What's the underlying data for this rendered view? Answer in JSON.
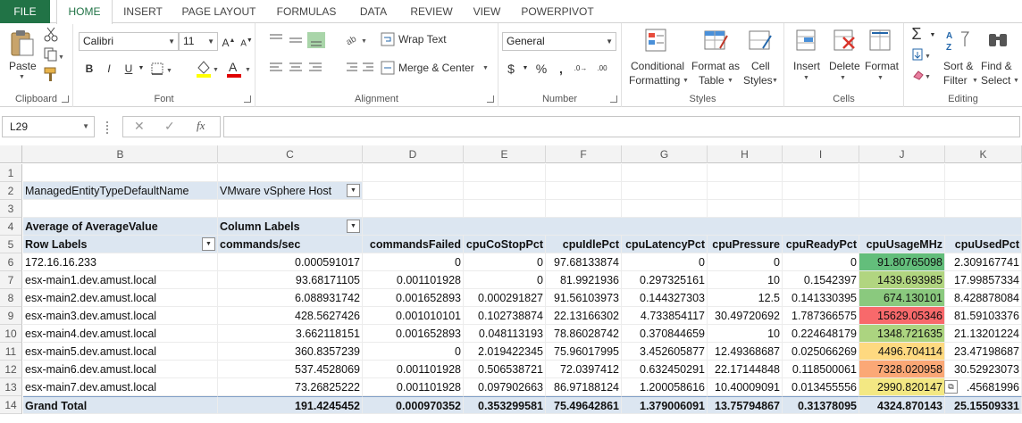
{
  "tabs": [
    "FILE",
    "HOME",
    "INSERT",
    "PAGE LAYOUT",
    "FORMULAS",
    "DATA",
    "REVIEW",
    "VIEW",
    "POWERPIVOT"
  ],
  "ribbon": {
    "clipboard": {
      "paste": "Paste",
      "label": "Clipboard"
    },
    "font": {
      "name": "Calibri",
      "size": "11",
      "label": "Font"
    },
    "alignment": {
      "wrap": "Wrap Text",
      "merge": "Merge & Center",
      "label": "Alignment"
    },
    "number": {
      "format": "General",
      "label": "Number"
    },
    "styles": {
      "conditional": "Conditional",
      "formatting": "Formatting",
      "format_as": "Format as",
      "table": "Table",
      "cell": "Cell",
      "styles_btn": "Styles",
      "label": "Styles"
    },
    "cells": {
      "insert": "Insert",
      "delete": "Delete",
      "format": "Format",
      "label": "Cells"
    },
    "editing": {
      "sort": "Sort &",
      "filter": "Filter",
      "find": "Find &",
      "select": "Select",
      "label": "Editing"
    }
  },
  "formula_bar": {
    "name_box": "L29",
    "fx": "fx",
    "content": ""
  },
  "columns": [
    "B",
    "C",
    "D",
    "E",
    "F",
    "G",
    "H",
    "I",
    "J",
    "K"
  ],
  "colors": {
    "brand": "#217346",
    "pivot_header": "#dce6f1"
  },
  "sheet": {
    "row_numbers": [
      "1",
      "2",
      "3",
      "4",
      "5",
      "6",
      "7",
      "8",
      "9",
      "10",
      "11",
      "12",
      "13",
      "14"
    ],
    "filter_field": "ManagedEntityTypeDefaultName",
    "filter_value": "VMware vSphere Host",
    "pivot_title": "Average of AverageValue",
    "column_labels": "Column Labels",
    "row_labels": "Row Labels",
    "headers": [
      "commands/sec",
      "commandsFailed",
      "cpuCoStopPct",
      "cpuIdlePct",
      "cpuLatencyPct",
      "cpuPressure",
      "cpuReadyPct",
      "cpuUsageMHz",
      "cpuUsedPct"
    ],
    "data": [
      {
        "label": "172.16.16.233",
        "values": [
          "0.000591017",
          "0",
          "0",
          "97.68133874",
          "0",
          "0",
          "0",
          "91.80765098",
          "2.309167741"
        ],
        "heat": "#63be7b"
      },
      {
        "label": "esx-main1.dev.amust.local",
        "values": [
          "93.68171105",
          "0.001101928",
          "0",
          "81.9921936",
          "0.297325161",
          "10",
          "0.1542397",
          "1439.693985",
          "17.99857334"
        ],
        "heat": "#b1d580"
      },
      {
        "label": "esx-main2.dev.amust.local",
        "values": [
          "6.088931742",
          "0.001652893",
          "0.000291827",
          "91.56103973",
          "0.144327303",
          "12.5",
          "0.141330395",
          "674.130101",
          "8.428878084"
        ],
        "heat": "#8ac97e"
      },
      {
        "label": "esx-main3.dev.amust.local",
        "values": [
          "428.5627426",
          "0.001010101",
          "0.102738874",
          "22.13166302",
          "4.733854117",
          "30.49720692",
          "1.787366575",
          "15629.05346",
          "81.59103376"
        ],
        "heat": "#f8696b"
      },
      {
        "label": "esx-main4.dev.amust.local",
        "values": [
          "3.662118151",
          "0.001652893",
          "0.048113193",
          "78.86028742",
          "0.370844659",
          "10",
          "0.224648179",
          "1348.721635",
          "21.13201224"
        ],
        "heat": "#acd480"
      },
      {
        "label": "esx-main5.dev.amust.local",
        "values": [
          "360.8357239",
          "0",
          "2.019422345",
          "75.96017995",
          "3.452605877",
          "12.49368687",
          "0.025066269",
          "4496.704114",
          "23.47198687"
        ],
        "heat": "#fed980"
      },
      {
        "label": "esx-main6.dev.amust.local",
        "values": [
          "537.4528069",
          "0.001101928",
          "0.506538721",
          "72.0397412",
          "0.632450291",
          "22.17144848",
          "0.118500061",
          "7328.020958",
          "30.52923073"
        ],
        "heat": "#fba876"
      },
      {
        "label": "esx-main7.dev.amust.local",
        "values": [
          "73.26825222",
          "0.001101928",
          "0.097902663",
          "86.97188124",
          "1.200058616",
          "10.40009091",
          "0.013455556",
          "2990.820147",
          ".45681996"
        ],
        "heat": "#f3e883"
      }
    ],
    "grand_total": {
      "label": "Grand Total",
      "values": [
        "191.4245452",
        "0.000970352",
        "0.353299581",
        "75.49642861",
        "1.379006091",
        "13.75794867",
        "0.31378095",
        "4324.870143",
        "25.15509331"
      ]
    }
  }
}
